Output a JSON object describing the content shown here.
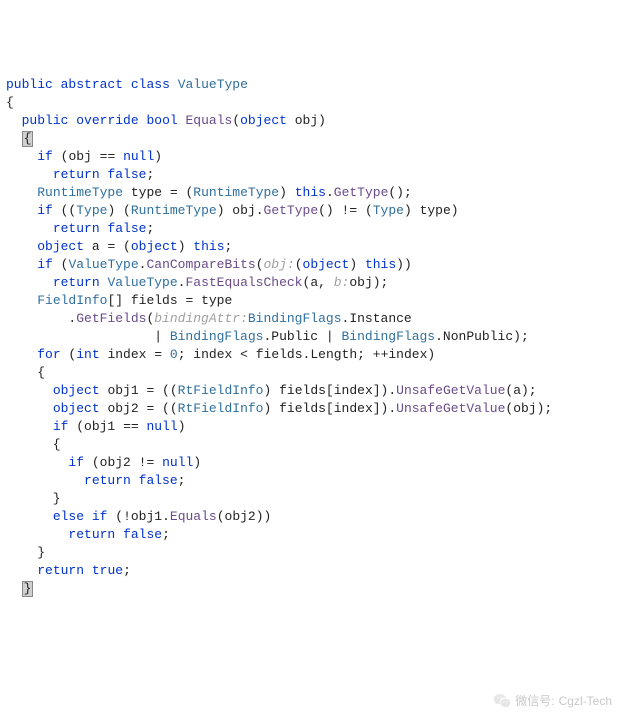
{
  "code": {
    "kw_public": "public",
    "kw_abstract": "abstract",
    "kw_class": "class",
    "kw_override": "override",
    "kw_bool": "bool",
    "kw_object": "object",
    "kw_if": "if",
    "kw_else": "else",
    "kw_return": "return",
    "kw_null": "null",
    "kw_false": "false",
    "kw_true": "true",
    "kw_this": "this",
    "kw_for": "for",
    "kw_int": "int",
    "class_name": "ValueType",
    "method_Equals": "Equals",
    "param_obj": "obj",
    "type_RuntimeType": "RuntimeType",
    "var_type": "type",
    "type_Type": "Type",
    "method_GetType": "GetType",
    "var_a": "a",
    "method_CanCompareBits": "CanCompareBits",
    "hint_obj": "obj:",
    "method_FastEqualsCheck": "FastEqualsCheck",
    "hint_b": "b:",
    "type_FieldInfo": "FieldInfo",
    "var_fields": "fields",
    "method_GetFields": "GetFields",
    "hint_bindingAttr": "bindingAttr:",
    "type_BindingFlags": "BindingFlags",
    "enum_Instance": "Instance",
    "enum_Public": "Public",
    "enum_NonPublic": "NonPublic",
    "var_index": "index",
    "num_zero": "0",
    "prop_Length": "Length",
    "var_obj1": "obj1",
    "var_obj2": "obj2",
    "type_RtFieldInfo": "RtFieldInfo",
    "method_UnsafeGetValue": "UnsafeGetValue",
    "op_eq": "==",
    "op_neq": "!=",
    "op_preinc": "++",
    "op_not": "!"
  },
  "watermark": {
    "label": "微信号:",
    "value": "Cgzl-Tech"
  }
}
